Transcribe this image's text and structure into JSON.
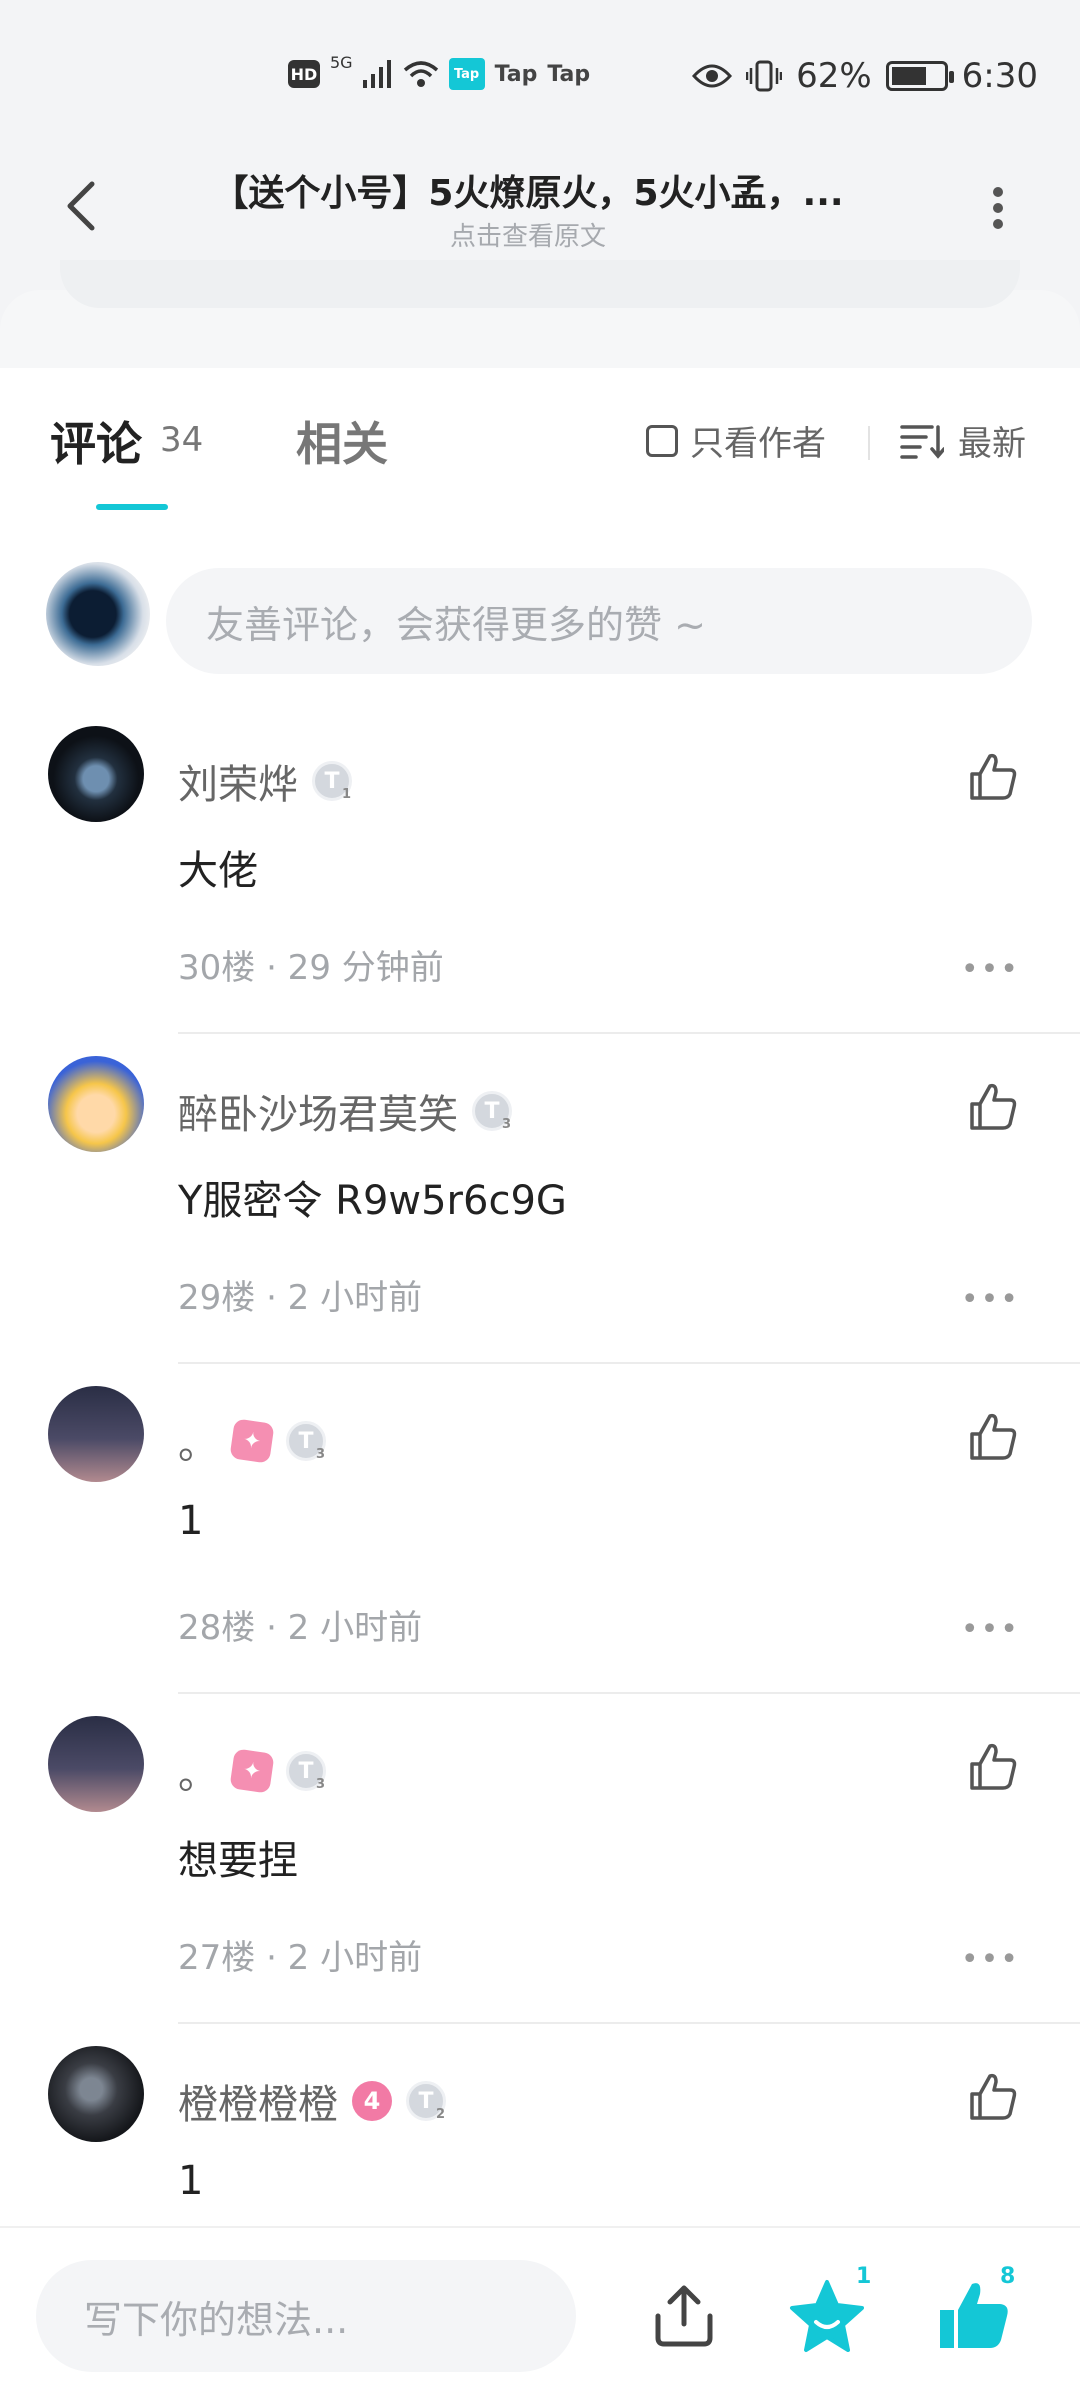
{
  "status_bar": {
    "hd": "HD",
    "net": "5G",
    "tap_logo": "Tap",
    "tap1": "Tap",
    "tap2": "Tap",
    "battery": "62%",
    "time": "6:30"
  },
  "nav": {
    "title": "【送个小号】5火燎原火，5火小孟，...",
    "subtitle": "点击查看原文",
    "back_icon": "chevron-left-icon",
    "more_icon": "more-vertical-icon"
  },
  "tabs": {
    "comments_label": "评论",
    "comments_count": "34",
    "related_label": "相关",
    "author_only_label": "只看作者",
    "sort_label": "最新"
  },
  "comment_input": {
    "placeholder": "友善评论，会获得更多的赞 ~"
  },
  "comments": [
    {
      "name": "刘荣烨",
      "text": "大佬",
      "floor": "30楼 · 29 分钟前",
      "badges": [
        "T1"
      ]
    },
    {
      "name": "醉卧沙场君莫笑",
      "text": "Y服密令 R9w5r6c9G",
      "floor": "29楼 · 2 小时前",
      "badges": [
        "T3"
      ]
    },
    {
      "name": "。",
      "text": "1",
      "floor": "28楼 · 2 小时前",
      "badges": [
        "pink",
        "T3"
      ]
    },
    {
      "name": "。",
      "text": "想要捏",
      "floor": "27楼 · 2 小时前",
      "badges": [
        "pink",
        "T3"
      ]
    },
    {
      "name": "橙橙橙橙",
      "text": "1",
      "floor": "",
      "badges": [
        "4",
        "T2"
      ]
    }
  ],
  "bottom_bar": {
    "placeholder": "写下你的想法...",
    "fav_count": "1",
    "like_count": "8",
    "accent_color": "#14c7d6"
  }
}
